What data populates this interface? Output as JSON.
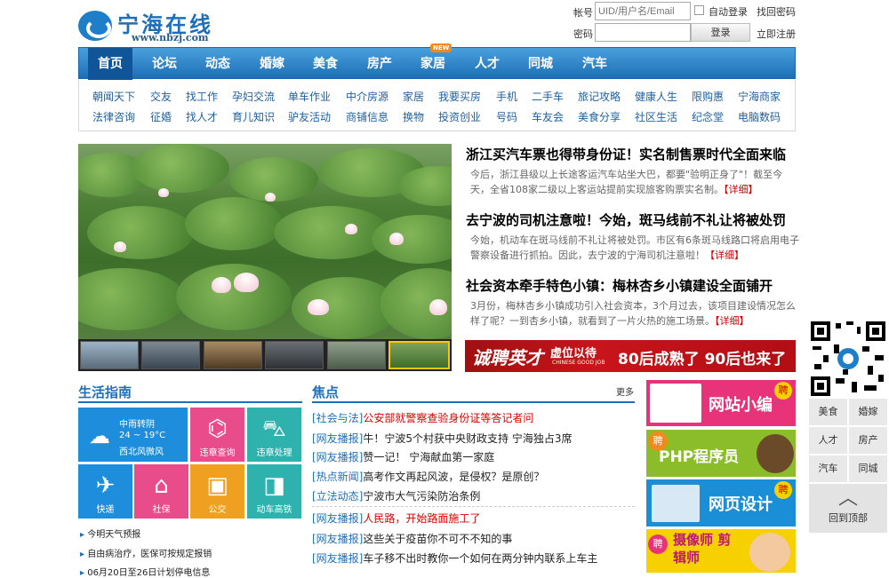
{
  "logo": {
    "name": "宁海在线",
    "url": "www.nbzj.com"
  },
  "login": {
    "account_label": "帐号",
    "account_placeholder": "UID/用户名/Email",
    "auto_login": "自动登录",
    "find_password": "找回密码",
    "password_label": "密码",
    "login_button": "登录",
    "register": "立即注册"
  },
  "nav": {
    "items": [
      "首页",
      "论坛",
      "动态",
      "婚嫁",
      "美食",
      "房产",
      "家居",
      "人才",
      "同城",
      "汽车"
    ],
    "new_badge": "NEW"
  },
  "subnav": {
    "row1": [
      "朝闻天下",
      "交友",
      "找工作",
      "孕妇交流",
      "单车作业",
      "中介房源",
      "家居",
      "我要买房",
      "手机",
      "二手车",
      "旅记攻略",
      "健康人生",
      "限购惠",
      "宁海商家"
    ],
    "row2": [
      "法律咨询",
      "征婚",
      "找人才",
      "育儿知识",
      "驴友活动",
      "商铺信息",
      "换物",
      "投资创业",
      "号码",
      "车友会",
      "美食分享",
      "社区生活",
      "纪念堂",
      "电脑数码"
    ]
  },
  "headlines": [
    {
      "title": "浙江买汽车票也得带身份证！实名制售票时代全面来临",
      "desc": "今后，浙江县级以上长途客运汽车站坐大巴，都要\"验明正身了\"！截至今天，全省108家二级以上客运站提前实现旅客购票实名制。",
      "more": "【详细】"
    },
    {
      "title": "去宁波的司机注意啦！今始，斑马线前不礼让将被处罚",
      "desc": "今始，机动车在斑马线前不礼让将被处罚。市区有6条斑马线路口将启用电子警察设备进行抓拍。因此，去宁波的宁海司机注意啦！",
      "more": "【详细】"
    },
    {
      "title": "社会资本牵手特色小镇：梅林杏乡小镇建设全面铺开",
      "desc": "3月份，梅林杏乡小镇成功引入社会资本，3个月过去，该项目建设情况怎么样了呢？一到杏乡小镇，就看到了一片火热的施工场景。",
      "more": "【详细】"
    }
  ],
  "banner": {
    "left": "诚聘英才",
    "tag": "虚位以待",
    "sub": "CHINESE GOOD JOB",
    "right": "80后成熟了 90后也来了"
  },
  "life": {
    "title": "生活指南",
    "weather": {
      "desc": "中雨转阴",
      "temp": "24 ~ 19°C",
      "wind": "西北风微风"
    },
    "tiles": [
      "违章查询",
      "违章处理",
      "快递",
      "社保",
      "公交",
      "动车高铁"
    ],
    "links": [
      "今明天气预报",
      "自由病治疗，医保可按规定报销",
      "06月20日至26日计划停电信息"
    ]
  },
  "focus": {
    "title": "焦点",
    "more": "更多",
    "items": [
      {
        "cat": "[社会与法]",
        "title": "公安部就警察查验身份证等答记者问",
        "red": true
      },
      {
        "cat": "[网友播报]",
        "title": "牛！宁波5个村获中央财政支持 宁海独占3席",
        "red": false
      },
      {
        "cat": "[网友播报]",
        "title": "赞一记！ 宁海献血第一家庭",
        "red": false
      },
      {
        "cat": "[热点新闻]",
        "title": "高考作文再起风波，是侵权？是原创？",
        "red": false
      },
      {
        "cat": "[立法动态]",
        "title": "宁波市大气污染防治条例",
        "red": false
      },
      {
        "cat": "[网友播报]",
        "title": "人民路，开始路面施工了",
        "red": true
      },
      {
        "cat": "[网友播报]",
        "title": "这些关于疫苗你不可不不知的事",
        "red": false
      },
      {
        "cat": "[网友播报]",
        "title": "车子移不出时教你一个如何在两分钟内联系上车主",
        "red": false
      }
    ]
  },
  "ads": [
    {
      "text": "网站小编",
      "badge": "聘"
    },
    {
      "text": "PHP程序员",
      "badge": "聘"
    },
    {
      "text": "网页设计",
      "badge": "聘"
    },
    {
      "text": "摄像师 剪辑师",
      "badge": "聘"
    }
  ],
  "sidebar": {
    "cells": [
      "美食",
      "婚嫁",
      "人才",
      "房产",
      "汽车",
      "同城"
    ],
    "back_top": "回到顶部"
  },
  "colors": {
    "brand": "#1e6fba",
    "nav": "#2b83c9",
    "red": "#d00000"
  }
}
